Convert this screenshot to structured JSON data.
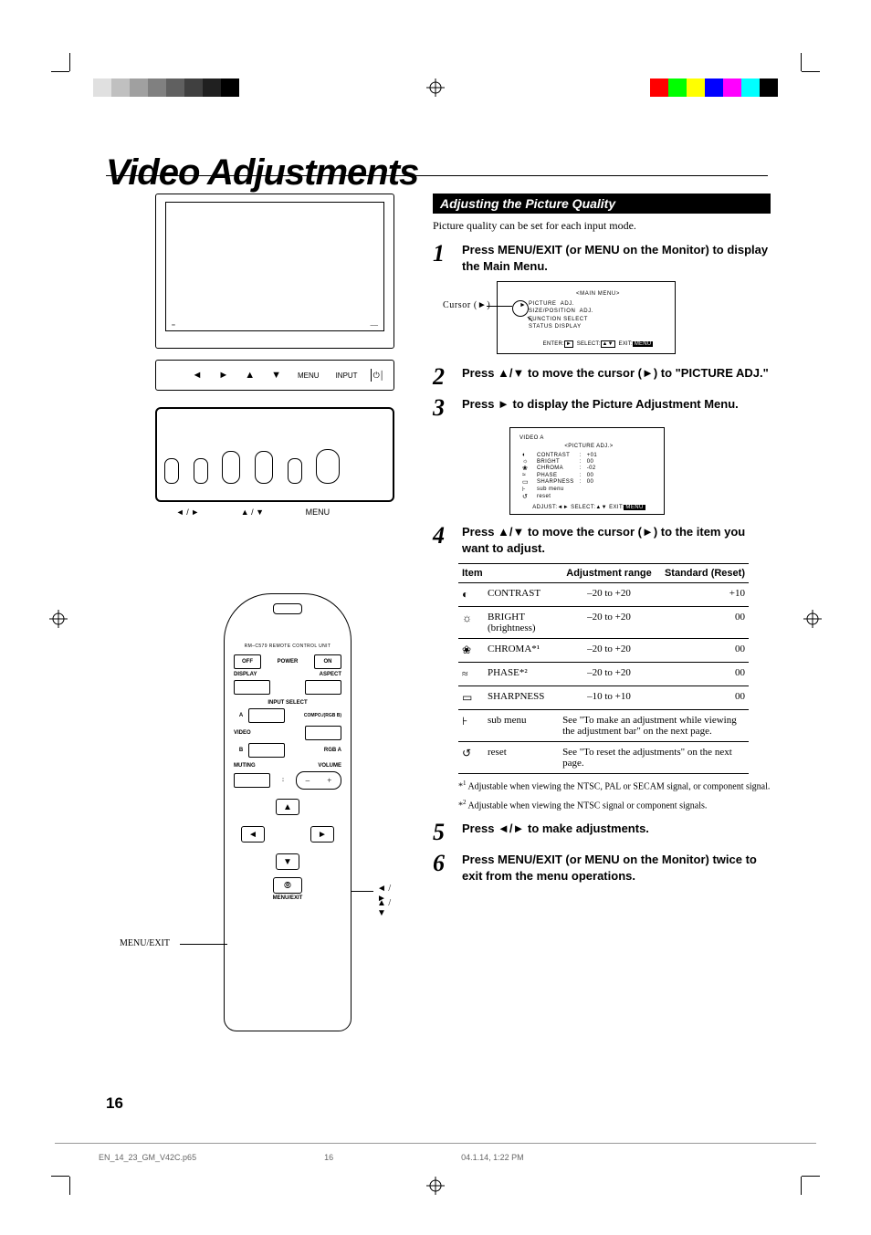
{
  "page_title": "Video Adjustments",
  "section_title": "Adjusting the Picture Quality",
  "intro": "Picture quality can be set for each input mode.",
  "steps": {
    "1": "Press MENU/EXIT (or MENU on the Monitor) to display the Main Menu.",
    "2": "Press ▲/▼ to move the cursor (►) to \"PICTURE ADJ.\"",
    "3": "Press ► to display the Picture Adjustment Menu.",
    "4": "Press ▲/▼ to move the cursor (►) to the item you want to adjust.",
    "5": "Press ◄/► to make adjustments.",
    "6": "Press MENU/EXIT (or MENU on the Monitor) twice to exit from the menu operations."
  },
  "osd1": {
    "cursor_label": "Cursor (►)",
    "title": "<MAIN MENU>",
    "lines": [
      "PICTURE  ADJ.",
      "SIZE/POSITION  ADJ.",
      "FUNCTION SELECT",
      "STATUS DISPLAY"
    ],
    "footer_enter": "ENTER:",
    "footer_select": "SELECT:",
    "footer_exit": "EXIT:",
    "footer_exit_btn": "MENU"
  },
  "osd2": {
    "input": "VIDEO A",
    "title": "<PICTURE ADJ.>",
    "rows": [
      {
        "icon": "◐",
        "name": "CONTRAST",
        "val": "+01"
      },
      {
        "icon": "☼",
        "name": "BRIGHT",
        "val": "00"
      },
      {
        "icon": "❀",
        "name": "CHROMA",
        "val": "-02"
      },
      {
        "icon": "≈",
        "name": "PHASE",
        "val": "00"
      },
      {
        "icon": "▭",
        "name": "SHARPNESS",
        "val": "00"
      },
      {
        "icon": "⊦",
        "name": "sub menu",
        "val": ""
      },
      {
        "icon": "↺",
        "name": "reset",
        "val": ""
      }
    ],
    "ftr_adjust": "ADJUST:",
    "ftr_select": "SELECT:",
    "ftr_exit": "EXIT:",
    "ftr_exit_btn": "MENU"
  },
  "table": {
    "head": {
      "item": "Item",
      "range": "Adjustment range",
      "std": "Standard (Reset)"
    },
    "rows": [
      {
        "icon": "◐",
        "name": "CONTRAST",
        "range": "–20 to +20",
        "std": "+10"
      },
      {
        "icon": "☼",
        "name": "BRIGHT (brightness)",
        "range": "–20 to +20",
        "std": "00"
      },
      {
        "icon": "❀",
        "name": "CHROMA*¹",
        "range": "–20 to +20",
        "std": "00"
      },
      {
        "icon": "≈",
        "name": "PHASE*²",
        "range": "–20 to +20",
        "std": "00"
      },
      {
        "icon": "▭",
        "name": "SHARPNESS",
        "range": "–10 to +10",
        "std": "00"
      },
      {
        "icon": "⊦",
        "name": "sub menu",
        "note": "See \"To make an adjustment while viewing the adjustment bar\" on the next page."
      },
      {
        "icon": "↺",
        "name": "reset",
        "note": "See \"To reset the adjustments\" on the next page."
      }
    ]
  },
  "footnotes": {
    "1": "Adjustable when viewing the NTSC, PAL or SECAM signal, or component signal.",
    "2": "Adjustable when viewing the NTSC signal or component signals."
  },
  "front_panel": {
    "row_labels": "◄    ►    ▲    ▼    MENU   INPUT",
    "under_left": "◄ / ►",
    "under_mid": "▲ / ▼",
    "under_menu": "MENU"
  },
  "remote": {
    "sub": "RM–C579 REMOTE CONTROL UNIT",
    "power_off": "OFF",
    "power_lbl": "POWER",
    "power_on": "ON",
    "display": "DISPLAY",
    "aspect": "ASPECT",
    "input_select": "INPUT SELECT",
    "a": "A",
    "compo": "COMPO./(RGB B)",
    "video": "VIDEO",
    "b": "B",
    "rgba": "RGB A",
    "muting": "MUTING",
    "volume": "VOLUME",
    "vol_minus": "–",
    "vol_plus": "+",
    "menu_exit": "MENU/EXIT",
    "callout_left": "MENU/EXIT",
    "callout_right_top": "◄ / ►",
    "callout_right_bot": "▲ / ▼"
  },
  "page_number": "16",
  "footer": {
    "file": "EN_14_23_GM_V42C.p65",
    "page": "16",
    "date": "04.1.14, 1:22 PM"
  }
}
